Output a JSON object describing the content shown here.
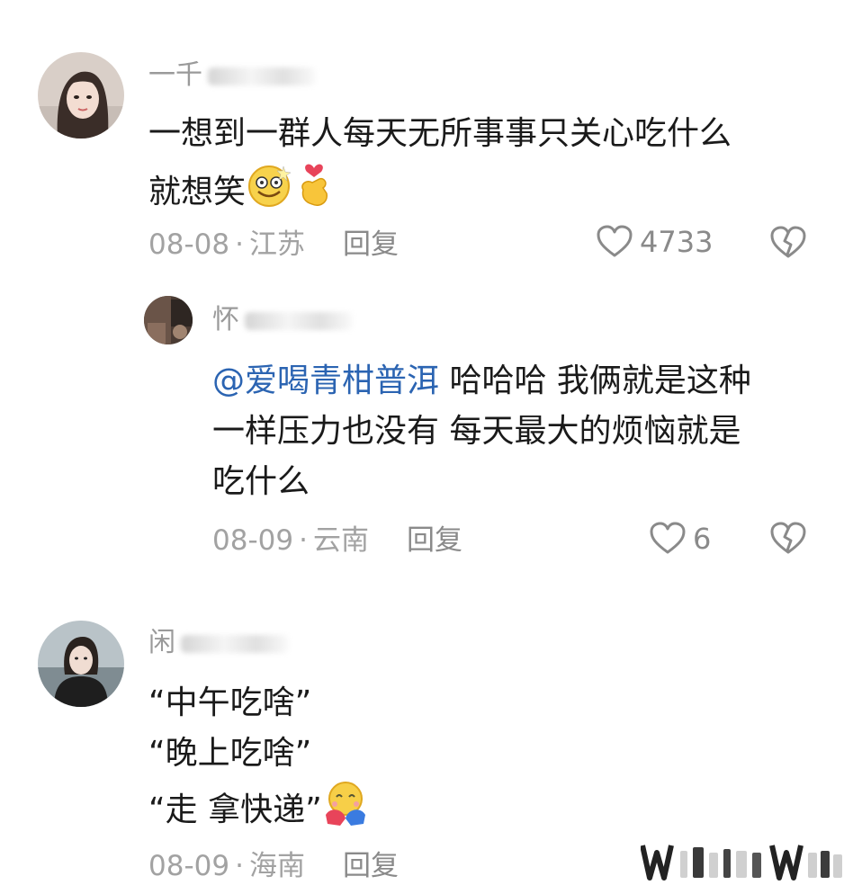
{
  "comments": [
    {
      "username": "一千",
      "text_lines": [
        "一想到一群人每天无所事事只关心吃什么",
        "就想笑"
      ],
      "date": "08-08",
      "location": "江苏",
      "reply_label": "回复",
      "likes": "4733",
      "avatar_icon": "woman-portrait-avatar",
      "emoji_icons": [
        "grinning-dizzy-face-emoji",
        "hand-heart-emoji"
      ]
    },
    {
      "username": "怀",
      "mention": "@爱喝青柑普洱",
      "text_lines": [
        "哈哈哈 我俩就是这种",
        "一样压力也没有 每天最大的烦恼就是",
        "吃什么"
      ],
      "date": "08-09",
      "location": "云南",
      "reply_label": "回复",
      "likes": "6",
      "avatar_icon": "dark-room-avatar"
    },
    {
      "username": "闲",
      "text_lines": [
        "“中午吃啥”",
        "“晚上吃啥”",
        "“走 拿快递”"
      ],
      "date": "08-09",
      "location": "海南",
      "reply_label": "回复",
      "avatar_icon": "woman-dark-coat-avatar",
      "emoji_icons": [
        "hugging-face-emoji"
      ]
    }
  ],
  "separator": "·",
  "watermark": "W",
  "icons": {
    "like": "heart-outline-icon",
    "dislike": "broken-heart-icon"
  },
  "colors": {
    "mention": "#2b64b2",
    "meta": "#a2a2a2",
    "text": "#1a1a1a"
  }
}
